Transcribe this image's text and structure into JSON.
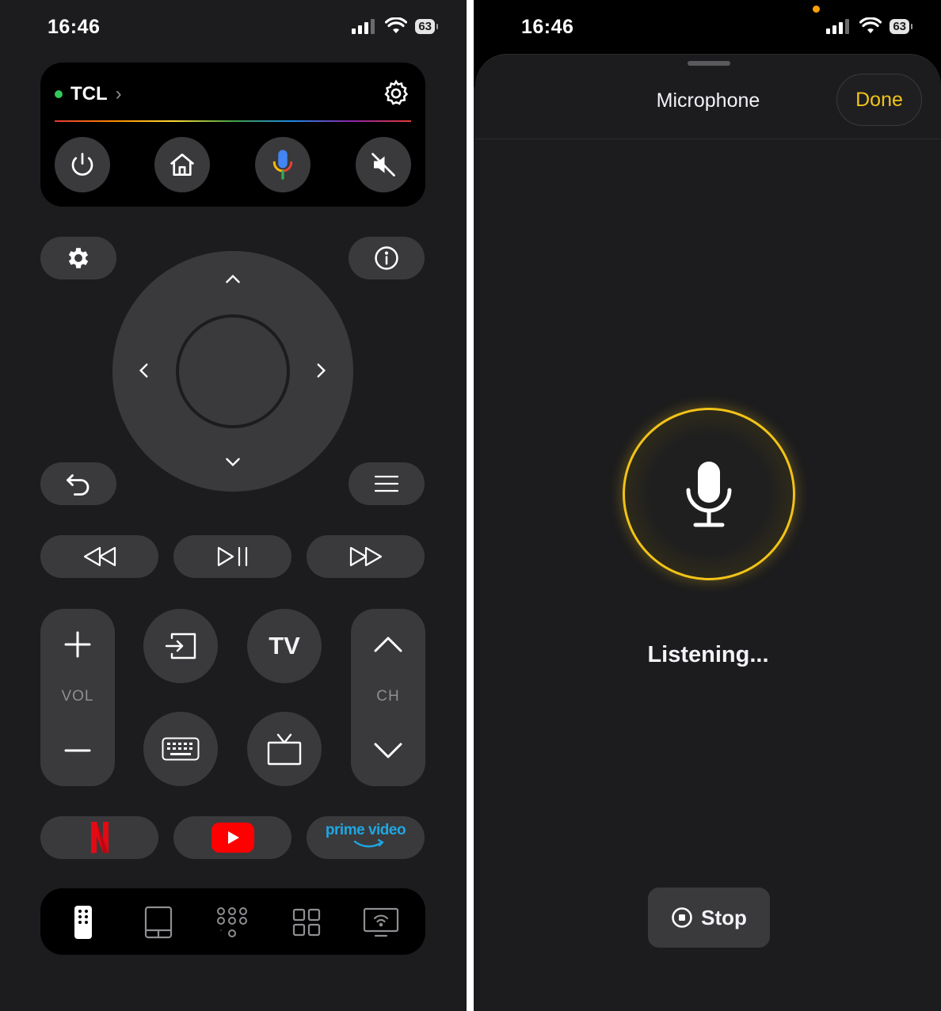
{
  "status_bar": {
    "time": "16:46",
    "battery": "63"
  },
  "remote": {
    "device": {
      "name": "TCL"
    },
    "dpad": {},
    "labels": {
      "tv": "TV",
      "vol": "VOL",
      "ch": "CH"
    },
    "apps": {
      "prime_video_line1": "prime video"
    },
    "colors": {
      "accent_yellow": "#f0c419",
      "online_green": "#34c759",
      "netflix_red": "#e50914",
      "youtube_red": "#ff0000",
      "prime_blue": "#1ea7e4"
    }
  },
  "microphone_sheet": {
    "title": "Microphone",
    "done_label": "Done",
    "listening_text": "Listening...",
    "stop_label": "Stop"
  }
}
